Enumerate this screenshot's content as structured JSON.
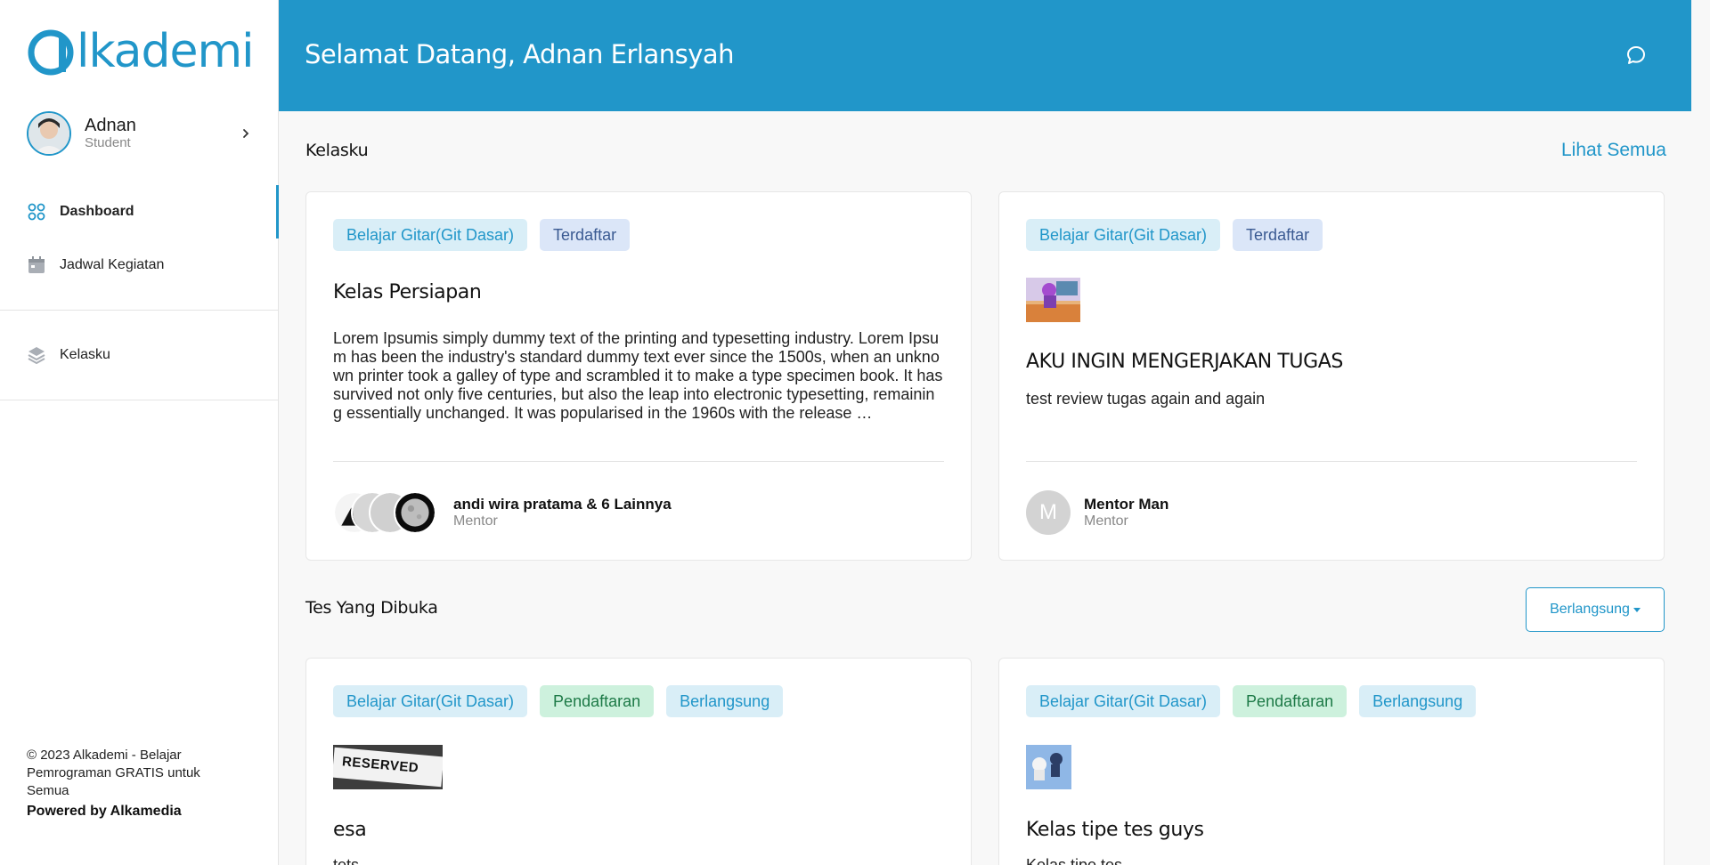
{
  "brand": {
    "logo_text": "lkademi",
    "accent": "#2196c9"
  },
  "user": {
    "name": "Adnan",
    "role": "Student"
  },
  "nav": {
    "items": [
      {
        "label": "Dashboard",
        "icon": "grid-icon",
        "active": true
      },
      {
        "label": "Jadwal Kegiatan",
        "icon": "calendar-icon",
        "active": false
      },
      {
        "label": "Kelasku",
        "icon": "layers-icon",
        "active": false
      }
    ]
  },
  "footer": {
    "copyright": "© 2023 Alkademi - Belajar Pemrograman GRATIS untuk Semua",
    "powered": "Powered by Alkamedia"
  },
  "header": {
    "title": "Selamat Datang, Adnan Erlansyah",
    "icon": "chat-icon"
  },
  "kelasku": {
    "title": "Kelasku",
    "see_all": "Lihat Semua",
    "cards": [
      {
        "badges": [
          "Belajar Gitar(Git Dasar)",
          "Terdaftar"
        ],
        "title": "Kelas Persiapan",
        "description": "Lorem Ipsumis simply dummy text of the printing and typesetting industry. Lorem Ipsum has been the industry's standard dummy text ever since the 1500s, when an unknown printer took a galley of type and scrambled it to make a type specimen book. It has survived not only five centuries, but also the leap into electronic typesetting, remaining essentially unchanged. It was popularised in the 1960s with the release …",
        "mentor_name": "andi wira pratama & 6 Lainnya",
        "mentor_role": "Mentor"
      },
      {
        "badges": [
          "Belajar Gitar(Git Dasar)",
          "Terdaftar"
        ],
        "title": "AKU INGIN MENGERJAKAN TUGAS",
        "description": "test review tugas again and again",
        "mentor_initial": "M",
        "mentor_name": "Mentor Man",
        "mentor_role": "Mentor"
      }
    ]
  },
  "tests": {
    "title": "Tes Yang Dibuka",
    "filter_label": "Berlangsung",
    "cards": [
      {
        "badges": [
          "Belajar Gitar(Git Dasar)",
          "Pendaftaran",
          "Berlangsung"
        ],
        "image_text": "RESERVED",
        "title": "esa",
        "description": "tets"
      },
      {
        "badges": [
          "Belajar Gitar(Git Dasar)",
          "Pendaftaran",
          "Berlangsung"
        ],
        "title": "Kelas tipe tes guys",
        "description": "Kelas tipe tes"
      }
    ]
  }
}
